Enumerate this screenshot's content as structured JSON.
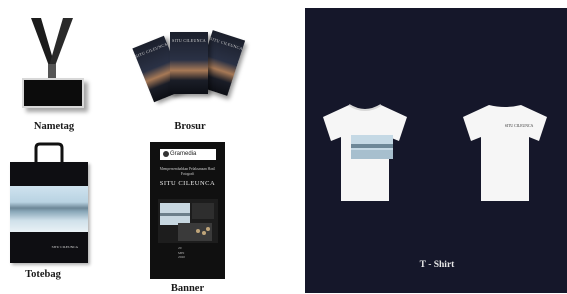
{
  "labels": {
    "nametag": "Nametag",
    "brosur": "Brosur",
    "totebag": "Totebag",
    "banner": "Banner",
    "tshirt": "T - Shirt"
  },
  "brosur": {
    "cover_text": "SITU CILEUNCA"
  },
  "totebag": {
    "brand": "SITU CILEUNCA"
  },
  "banner": {
    "logo": "Gramedia",
    "subtitle": "Mempersembahkan Pelaksanaan Hasil Fotografi",
    "title": "SITU CILEUNCA",
    "date_lines": [
      "20",
      "MEI",
      "2020"
    ]
  },
  "tshirt": {
    "back_text": "SITU CILEUNCA"
  },
  "colors": {
    "panel_bg": "#15172a",
    "dark_print": "#0c0c0c",
    "label_text": "#1a1a1a"
  }
}
